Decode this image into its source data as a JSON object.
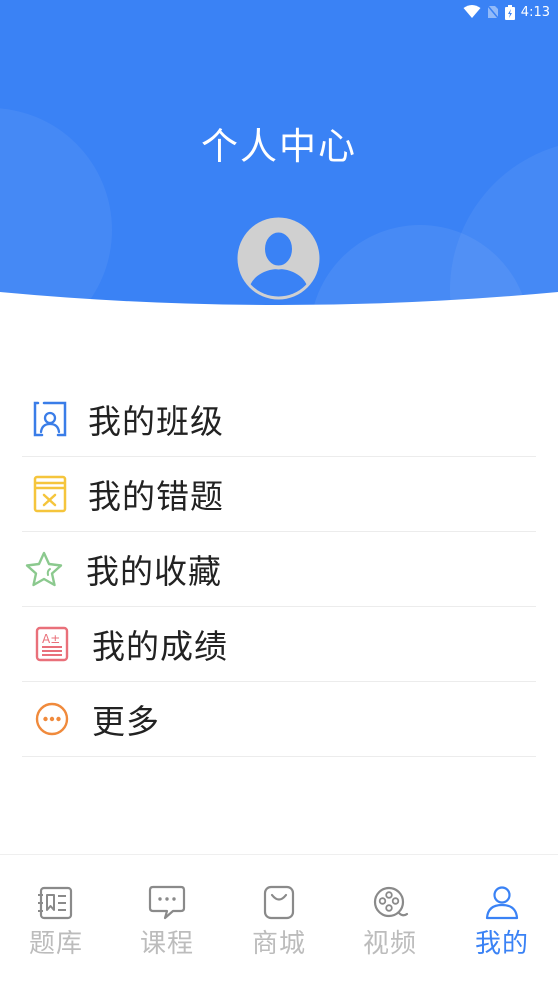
{
  "status_bar": {
    "time": "4:13",
    "icons": [
      "wifi-icon",
      "no-sim-icon",
      "battery-charging-icon"
    ]
  },
  "header": {
    "title": "个人中心",
    "background_color": "#3a82f5",
    "avatar_icon": "default-avatar-icon"
  },
  "menu": {
    "items": [
      {
        "label": "我的班级",
        "icon": "class-icon",
        "color": "#3a7de8"
      },
      {
        "label": "我的错题",
        "icon": "wrong-questions-icon",
        "color": "#f5c53c"
      },
      {
        "label": "我的收藏",
        "icon": "star-icon",
        "color": "#8bc98e"
      },
      {
        "label": "我的成绩",
        "icon": "grades-icon",
        "color": "#e9707a"
      },
      {
        "label": "更多",
        "icon": "more-icon",
        "color": "#f08a3c"
      }
    ]
  },
  "tabbar": {
    "active_color": "#3a82f5",
    "inactive_color": "#bcbcbc",
    "tabs": [
      {
        "label": "题库",
        "icon": "question-bank-icon",
        "active": false
      },
      {
        "label": "课程",
        "icon": "course-chat-icon",
        "active": false
      },
      {
        "label": "商城",
        "icon": "shop-bag-icon",
        "active": false
      },
      {
        "label": "视频",
        "icon": "film-reel-icon",
        "active": false
      },
      {
        "label": "我的",
        "icon": "profile-icon",
        "active": true
      }
    ]
  }
}
